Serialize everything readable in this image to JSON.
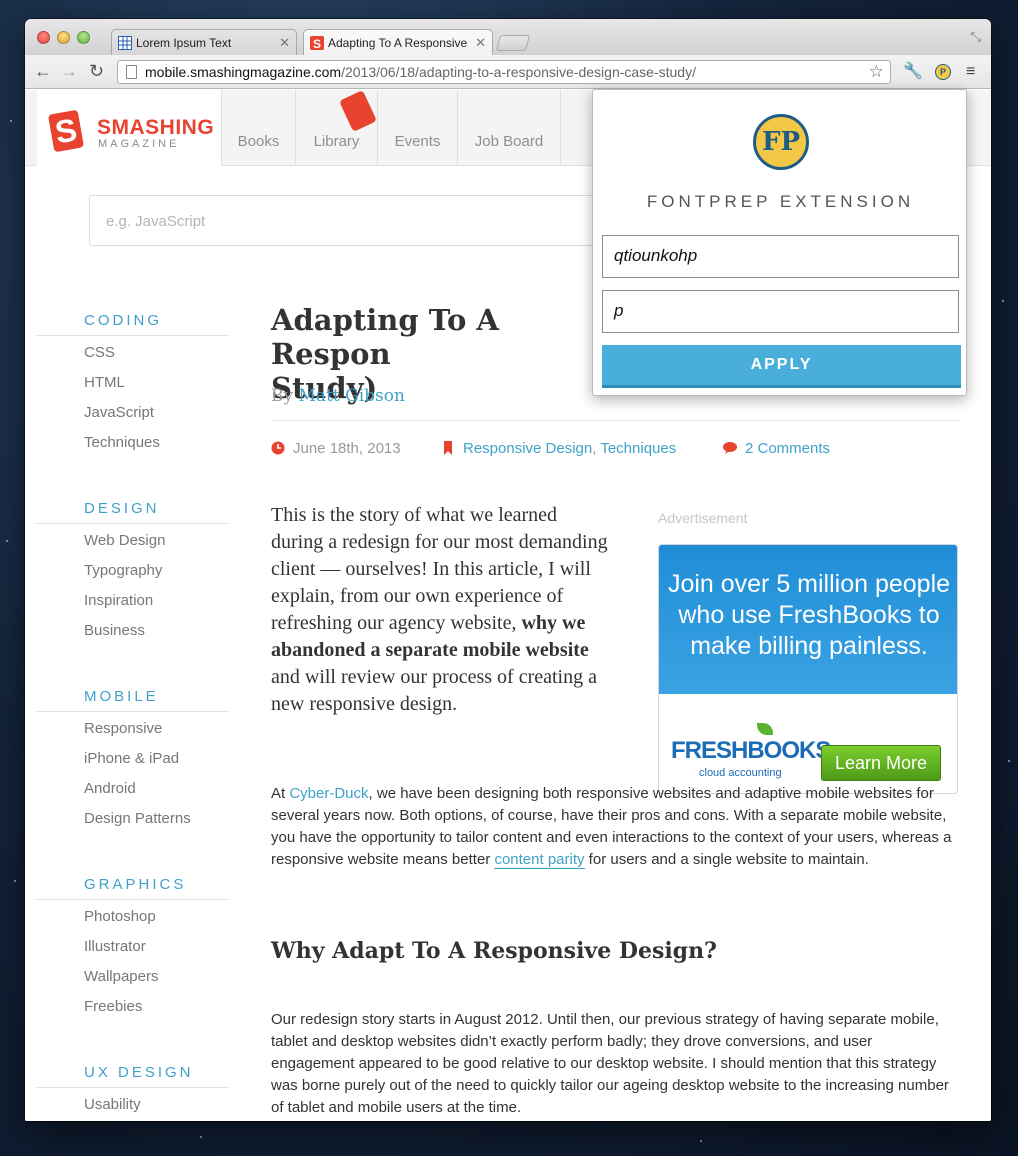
{
  "tabs": [
    {
      "title": "Lorem Ipsum Text"
    },
    {
      "title": "Adapting To A Responsive"
    }
  ],
  "toolbar": {
    "url_host": "mobile.smashingmagazine.com",
    "url_path": "/2013/06/18/adapting-to-a-responsive-design-case-study/"
  },
  "site": {
    "logo_word": "SMASHING",
    "logo_sub": "MAGAZINE",
    "nav": [
      "Books",
      "Library",
      "Events",
      "Job Board"
    ],
    "search_placeholder": "e.g. JavaScript"
  },
  "sidebar": {
    "categories": [
      {
        "title": "CODING",
        "links": [
          "CSS",
          "HTML",
          "JavaScript",
          "Techniques"
        ]
      },
      {
        "title": "DESIGN",
        "links": [
          "Web Design",
          "Typography",
          "Inspiration",
          "Business"
        ]
      },
      {
        "title": "MOBILE",
        "links": [
          "Responsive",
          "iPhone & iPad",
          "Android",
          "Design Patterns"
        ]
      },
      {
        "title": "GRAPHICS",
        "links": [
          "Photoshop",
          "Illustrator",
          "Wallpapers",
          "Freebies"
        ]
      },
      {
        "title": "UX DESIGN",
        "links": [
          "Usability"
        ]
      }
    ]
  },
  "article": {
    "title": "Adapting To A Respon Study)",
    "title_line1": "Adapting To A Respon",
    "title_line2": "Study)",
    "by": "By",
    "author": "Matt Gibson",
    "date": "June 18th, 2013",
    "tag1": "Responsive Design",
    "tag_sep": ", ",
    "tag2": "Techniques",
    "comments": "2 Comments",
    "lead_a": "This is the story of what we learned during a redesign for our most demanding client — ourselves! In this article, I will explain, from our own experience of refreshing our agency website, ",
    "lead_b": "why we abandoned a separate mobile website",
    "lead_c": " and will review our process of creating a new responsive design.",
    "p1_a": "At ",
    "p1_link": "Cyber-Duck",
    "p1_b": ", we have been designing both responsive websites and adaptive mobile websites for several years now. Both options, of course, have their pros and cons. With a separate mobile website, you have the opportunity to tailor content and even interactions to the context of your users, whereas a responsive website means better ",
    "p1_link2": "content parity",
    "p1_c": " for users and a single website to maintain.",
    "h2": "Why Adapt To A Responsive Design?",
    "p2": "Our redesign story starts in August 2012. Until then, our previous strategy of having separate mobile, tablet and desktop websites didn’t exactly perform badly; they drove conversions, and user engagement appeared to be good relative to our desktop website. I should mention that this strategy was borne purely out of the need to quickly tailor our ageing desktop website to the increasing number of tablet and mobile users at the time."
  },
  "ad": {
    "label": "Advertisement",
    "headline": "Join over 5 million people who use FreshBooks to make billing painless.",
    "brand": "FRESHBOOKS",
    "brand_sub": "cloud accounting",
    "cta": "Learn More"
  },
  "popup": {
    "logo": "FP",
    "title": "FONTPREP EXTENSION",
    "input1": "qtiounkohp",
    "input2": "p",
    "apply": "APPLY"
  }
}
